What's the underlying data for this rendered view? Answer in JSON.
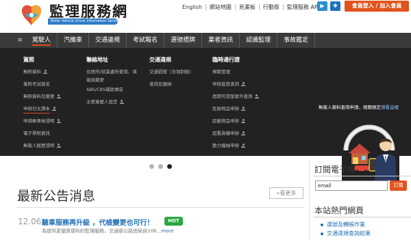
{
  "header": {
    "logo_title": "監理服務網",
    "logo_subtitle": "Motor Vehicle Driver Information Service",
    "top_links": [
      "English",
      "網站地圖",
      "見畫板",
      "行動版",
      "監理服務 APP"
    ],
    "app_icons": [
      "google-play-icon",
      "chrome-app-icon"
    ],
    "login_label": "會員登入 / 加入會員"
  },
  "nav": {
    "menu_icon": "≡",
    "tabs": [
      "駕駛人",
      "汽機車",
      "交通違規",
      "考試報名",
      "選號標牌",
      "業者資訊",
      "認識監理",
      "事故鑑定"
    ]
  },
  "mega_menu": {
    "columns": [
      {
        "title": "駕照",
        "items": [
          "無照資料",
          "駕照考試報名",
          "無照資料及變更",
          "申辦日文譯本",
          "申請無事故證明",
          "電子學照資訊",
          "無駕人經歷證明"
        ]
      },
      {
        "title": "聯絡地址",
        "items": [
          "住居所/就業處所查詢、填報與變更",
          "ABS/CBS補助專區",
          "主要駕駛人設定"
        ]
      },
      {
        "title": "交通違規",
        "items": [
          "交通罰鍰（含強制險）",
          "查詢及繳納"
        ]
      },
      {
        "title": "臨時通行證",
        "items": [
          "規範管理",
          "申辦進度查詢",
          "屆期可證發案件查詢",
          "危險物品申辦",
          "超載物品申辦",
          "超重貨櫃申辦",
          "動力機械申辦"
        ]
      }
    ],
    "promo_text": "無駕人資料查詢申請，相關規定",
    "promo_link": "請看這裡"
  },
  "slider": {
    "dots": 3,
    "active_index": 2
  },
  "news": {
    "section_title": "最新公告消息",
    "more_label": "»看更多",
    "items": [
      {
        "date": "12.06",
        "headline": "驗車服務再升級 ，代檢變更也可行！",
        "badge": "HOT",
        "summary": "為提供更優質便利的監理服務，交通部公路總局自108…",
        "read_more": "more"
      }
    ]
  },
  "sidebar": {
    "subscribe_title": "訂閱電子報",
    "email_value": "email",
    "subscribe_button": "訂閱",
    "hot_title": "本站熱門網頁",
    "hot_links": [
      "選號及轉帳作業",
      "交通違規查詢結果"
    ]
  },
  "colors": {
    "brand_orange": "#e0531d",
    "nav_bg": "#3a3a3a",
    "mega_bg": "#222222",
    "link_blue": "#1f6fb5",
    "hot_green": "#2aa640"
  }
}
